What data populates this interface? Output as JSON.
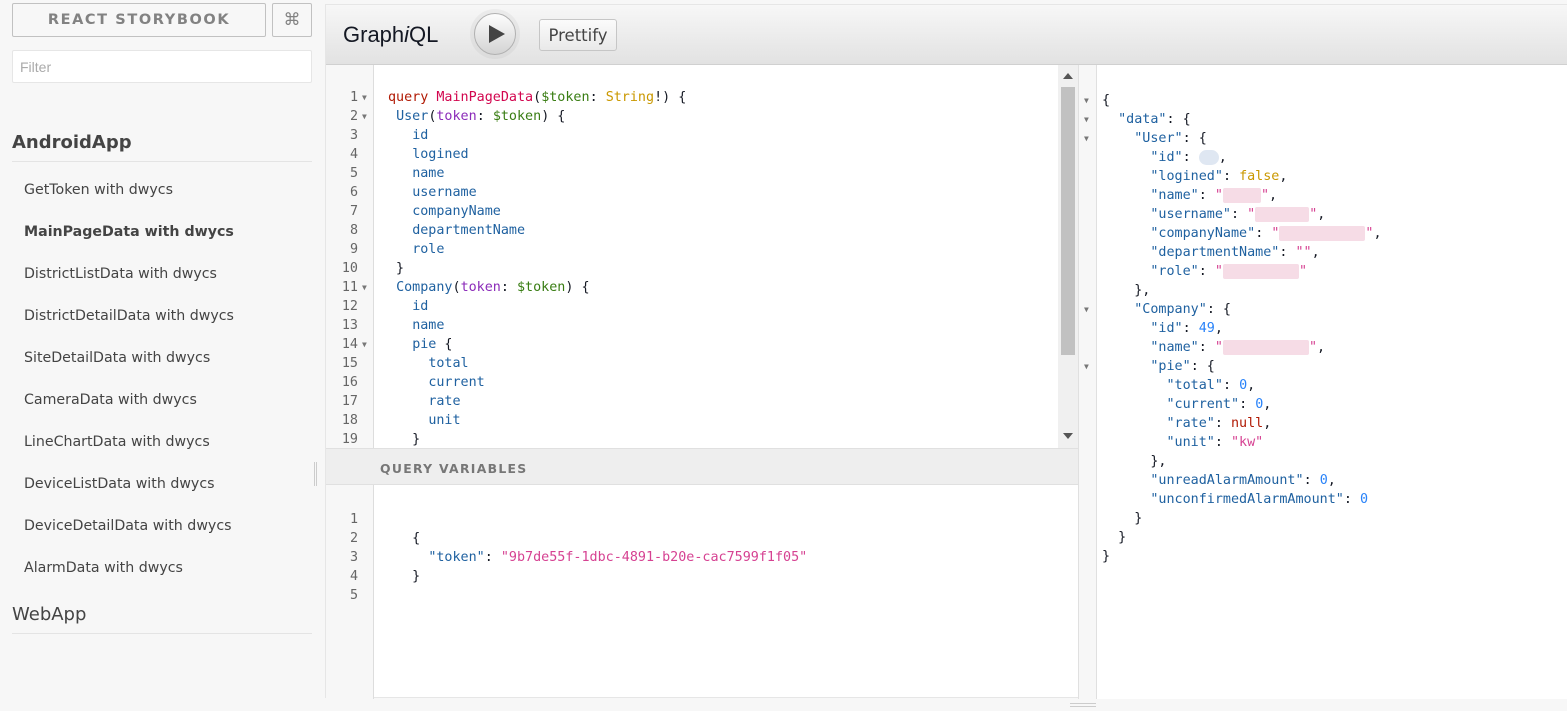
{
  "sidebar": {
    "title": "REACT STORYBOOK",
    "shortcut_icon": "⌘",
    "filter_placeholder": "Filter",
    "kinds": [
      {
        "name": "AndroidApp",
        "active": true,
        "stories": [
          "GetToken with dwycs",
          "MainPageData with dwycs",
          "DistrictListData with dwycs",
          "DistrictDetailData with dwycs",
          "SiteDetailData with dwycs",
          "CameraData with dwycs",
          "LineChartData with dwycs",
          "DeviceListData with dwycs",
          "DeviceDetailData with dwycs",
          "AlarmData with dwycs"
        ],
        "selected_story": "MainPageData with dwycs"
      },
      {
        "name": "WebApp",
        "active": false,
        "stories": []
      }
    ]
  },
  "graphiql": {
    "title_prefix": "Graph",
    "title_italic": "i",
    "title_suffix": "QL",
    "execute_icon": "play-icon",
    "prettify_label": "Prettify",
    "query_variables_label": "QUERY VARIABLES",
    "query_editor": {
      "line_numbers": [
        "1",
        "2",
        "3",
        "4",
        "5",
        "6",
        "7",
        "8",
        "9",
        "10",
        "11",
        "12",
        "13",
        "14",
        "15",
        "16",
        "17",
        "18",
        "19"
      ],
      "fold_markers_on_lines": [
        1,
        2,
        11,
        14
      ],
      "lines": [
        "query MainPageData($token: String!) {",
        " User(token: $token) {",
        "   id",
        "   logined",
        "   name",
        "   username",
        "   companyName",
        "   departmentName",
        "   role",
        " }",
        " Company(token: $token) {",
        "   id",
        "   name",
        "   pie {",
        "     total",
        "     current",
        "     rate",
        "     unit",
        "   }"
      ]
    },
    "variables_editor": {
      "line_numbers": [
        "1",
        "2",
        "3",
        "4",
        "5"
      ],
      "lines": [
        "",
        "   {",
        "     \"token\": \"9b7de55f-1dbc-4891-b20e-cac7599f1f05\"",
        "   }",
        ""
      ]
    },
    "result": {
      "lines": [
        "{",
        "  \"data\": {",
        "    \"User\": {",
        "      \"id\": ",
        "      \"logined\": false,",
        "      \"name\": \"\",",
        "      \"username\": \"\",",
        "      \"companyName\": \"\",",
        "      \"departmentName\": \"\",",
        "      \"role\": \"\"",
        "    },",
        "    \"Company\": {",
        "      \"id\": 49,",
        "      \"name\": \"\",",
        "      \"pie\": {",
        "        \"total\": 0,",
        "        \"current\": 0,",
        "        \"rate\": null,",
        "        \"unit\": \"kw\"",
        "      },",
        "      \"unreadAlarmAmount\": 0,",
        "      \"unconfirmedAlarmAmount\": 0",
        "    }",
        "  }",
        "}"
      ],
      "fold_markers_on_lines": [
        1,
        2,
        3,
        12,
        15
      ]
    }
  },
  "colors": {
    "keyword": "#b11a04",
    "definition": "#d2054e",
    "variable": "#397d13",
    "type": "#ca9800",
    "property": "#1f61a0",
    "string": "#d64292",
    "number": "#2882f9",
    "atom": "#b33086"
  }
}
